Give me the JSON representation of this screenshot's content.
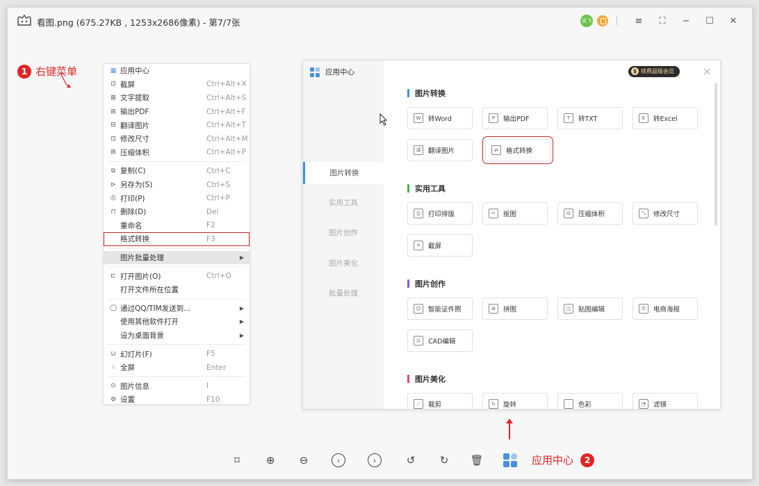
{
  "window": {
    "title": "看图.png (675.27KB , 1253x2686像素) - 第7/7张",
    "badge_text": "讯飞",
    "controls": [
      "≡",
      "⛶",
      "−",
      "☐",
      "✕"
    ]
  },
  "annotation1": {
    "number": "1",
    "label": "右键菜单"
  },
  "annotation2": {
    "number": "2",
    "label": "应用中心"
  },
  "context_menu": {
    "items": [
      {
        "icon": "▦",
        "label": "应用中心",
        "shortcut": ""
      },
      {
        "icon": "⊡",
        "label": "截屏",
        "shortcut": "Ctrl+Alt+X"
      },
      {
        "icon": "⊠",
        "label": "文字提取",
        "shortcut": "Ctrl+Alt+S"
      },
      {
        "icon": "⊞",
        "label": "输出PDF",
        "shortcut": "Ctrl+Alt+F"
      },
      {
        "icon": "⊟",
        "label": "翻译图片",
        "shortcut": "Ctrl+Alt+T"
      },
      {
        "icon": "⊡",
        "label": "修改尺寸",
        "shortcut": "Ctrl+Alt+M"
      },
      {
        "icon": "⊞",
        "label": "压缩体积",
        "shortcut": "Ctrl+Alt+P"
      },
      {
        "icon": "⧉",
        "label": "复制(C)",
        "shortcut": "Ctrl+C"
      },
      {
        "icon": "⊳",
        "label": "另存为(S)",
        "shortcut": "Ctrl+S"
      },
      {
        "icon": "⎙",
        "label": "打印(P)",
        "shortcut": "Ctrl+P"
      },
      {
        "icon": "⊓",
        "label": "删除(D)",
        "shortcut": "Del"
      },
      {
        "icon": "",
        "label": "重命名",
        "shortcut": "F2"
      },
      {
        "icon": "",
        "label": "格式转换",
        "shortcut": "F3"
      },
      {
        "icon": "",
        "label": "图片批量处理",
        "shortcut": ""
      },
      {
        "icon": "⊏",
        "label": "打开图片(O)",
        "shortcut": "Ctrl+O"
      },
      {
        "icon": "",
        "label": "打开文件所在位置",
        "shortcut": ""
      },
      {
        "icon": "◯",
        "label": "通过QQ/TIM发送到...",
        "shortcut": ""
      },
      {
        "icon": "",
        "label": "使用其他软件打开",
        "shortcut": ""
      },
      {
        "icon": "",
        "label": "设为桌面背景",
        "shortcut": ""
      },
      {
        "icon": "⊔",
        "label": "幻灯片(F)",
        "shortcut": "F5"
      },
      {
        "icon": "⁙",
        "label": "全屏",
        "shortcut": "Enter"
      },
      {
        "icon": "⊙",
        "label": "图片信息",
        "shortcut": "I"
      },
      {
        "icon": "⚙",
        "label": "设置",
        "shortcut": "F10"
      }
    ]
  },
  "app_center": {
    "title": "应用中心",
    "vip_label": "续费超级会员",
    "close": "×",
    "sidebar": [
      "图片转换",
      "实用工具",
      "图片创作",
      "图片美化",
      "批量处理"
    ],
    "sections": [
      {
        "title": "图片转换",
        "color": "#3e8ef7",
        "tools": [
          [
            "W",
            "转Word"
          ],
          [
            "P",
            "输出PDF"
          ],
          [
            "T",
            "转TXT"
          ],
          [
            "E",
            "转Excel"
          ],
          [
            "译",
            "翻译图片"
          ],
          [
            "⇄",
            "格式转换"
          ]
        ]
      },
      {
        "title": "实用工具",
        "color": "#3cb44b",
        "tools": [
          [
            "⎙",
            "打印排版"
          ],
          [
            "✂",
            "抠图"
          ],
          [
            "⊟",
            "压缩体积"
          ],
          [
            "⤡",
            "修改尺寸"
          ],
          [
            "✕",
            "截屏"
          ]
        ]
      },
      {
        "title": "图片创作",
        "color": "#7b5cf5",
        "tools": [
          [
            "☺",
            "智能证件照"
          ],
          [
            "⊞",
            "拼图"
          ],
          [
            "◫",
            "贴图编辑"
          ],
          [
            "⚿",
            "电商海报"
          ],
          [
            "⊡",
            "CAD编辑"
          ]
        ]
      },
      {
        "title": "图片美化",
        "color": "#e84a5f",
        "tools": [
          [
            "⟋",
            "裁剪"
          ],
          [
            "↻",
            "旋转"
          ],
          [
            "⫶",
            "色彩"
          ],
          [
            "◔",
            "滤镜"
          ]
        ]
      }
    ]
  },
  "toolbar": {
    "buttons": [
      "⌑",
      "⊕",
      "⊖",
      "‹",
      "›",
      "↺",
      "↻",
      "🗑"
    ]
  }
}
